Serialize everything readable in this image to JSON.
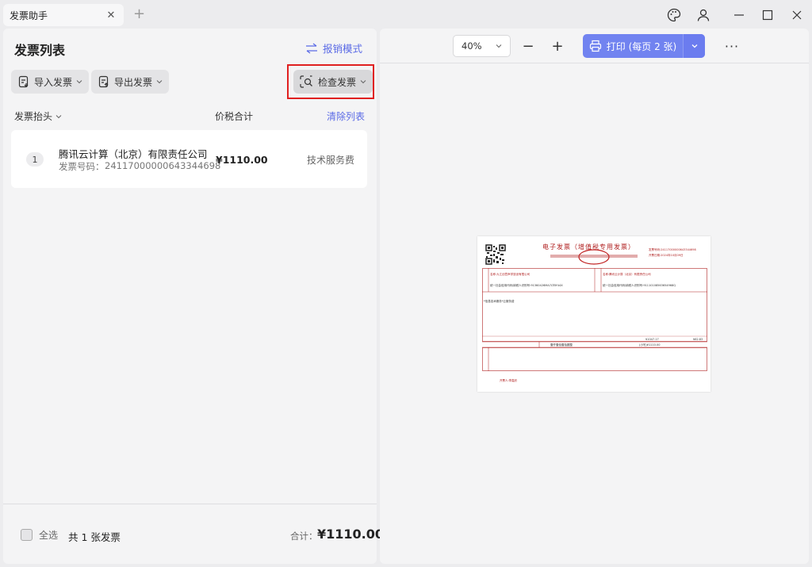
{
  "window": {
    "tab_title": "发票助手",
    "close_glyph": "✕",
    "add_glyph": "+"
  },
  "left": {
    "title": "发票列表",
    "reimbursement_mode": "报销模式",
    "import_label": "导入发票",
    "export_label": "导出发票",
    "check_label": "检查发票",
    "col_title": "发票抬头",
    "col_amount": "价税合计",
    "clear_list": "清除列表",
    "rows": [
      {
        "index": "1",
        "company": "腾讯云计算（北京）有限责任公司",
        "code_label": "发票号码：",
        "code": "24117000000643344698",
        "amount": "¥1110.00",
        "type": "技术服务费"
      }
    ],
    "footer": {
      "select_all": "全选",
      "count": "共 1 张发票",
      "total_label": "合计：",
      "total_value": "¥1110.00"
    }
  },
  "right": {
    "zoom": "40%",
    "zoom_out": "−",
    "zoom_in": "+",
    "print_label": "打印 (每页 2 张)",
    "more": "···"
  },
  "invoice_preview": {
    "title": "电子发票（增值税专用发票）",
    "number_label": "发票号码:24117000000643344698",
    "date_label": "开票日期:2024年10月09日",
    "buyer_name": "名称:九江创意声学放设有限公司",
    "buyer_tax": "统一社会信用代码/纳税人识别号:91360426MA7LTBY44X",
    "seller_name": "名称:腾讯云计算（北京）有限责任公司",
    "seller_tax": "统一社会信用代码/纳税人识别号:91110108563654968Q",
    "item": "*信息技术服务*云服务费",
    "amount_small": "¥1047.17",
    "tax_small": "¥62.83",
    "total_words": "壹仟壹佰壹拾圆整",
    "total_num": "(小写)¥1110.00",
    "issuer": "开票人:李嘉欣",
    "colors": {
      "red": "#b02020",
      "accent": "#7183f0"
    }
  }
}
